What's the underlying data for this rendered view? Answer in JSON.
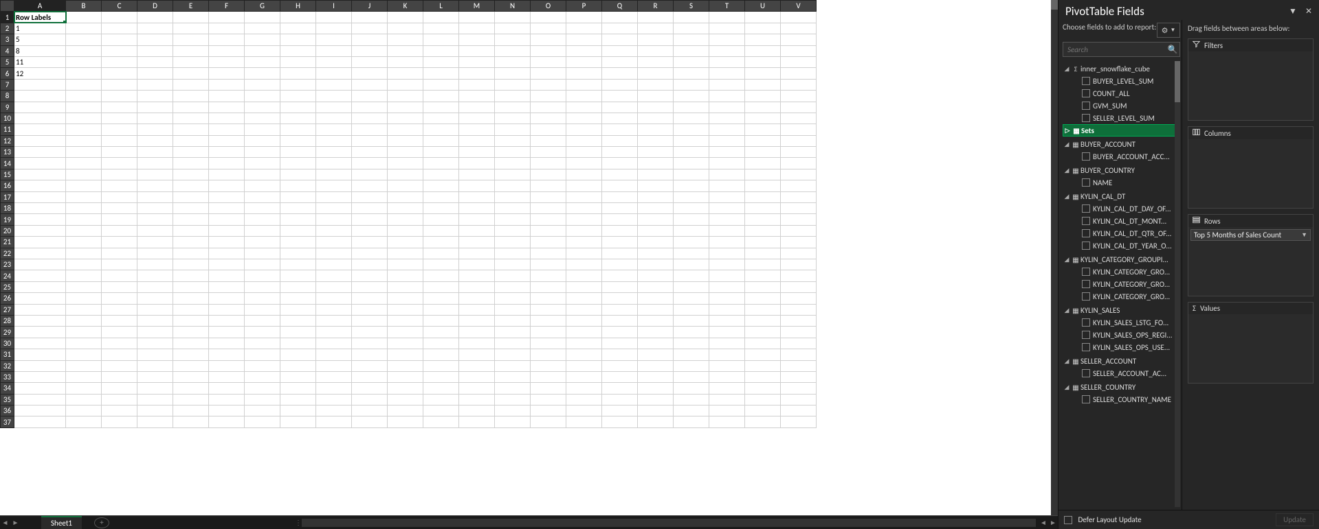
{
  "grid": {
    "columns": [
      "A",
      "B",
      "C",
      "D",
      "E",
      "F",
      "G",
      "H",
      "I",
      "J",
      "K",
      "L",
      "M",
      "N",
      "O",
      "P",
      "Q",
      "R",
      "S",
      "T",
      "U",
      "V"
    ],
    "row_count": 37,
    "cells": {
      "A1": "Row Labels",
      "A2": "1",
      "A3": "5",
      "A4": "8",
      "A5": "11",
      "A6": "12"
    },
    "active_cell": "A1"
  },
  "sheet_tabs": {
    "active": "Sheet1"
  },
  "pane": {
    "title": "PivotTable Fields",
    "choose_text": "Choose fields to add to report:",
    "search_placeholder": "Search",
    "drag_text": "Drag fields between areas below:",
    "areas": {
      "filters": "Filters",
      "columns": "Columns",
      "rows": "Rows",
      "values": "Values"
    },
    "rows_chip": "Top 5 Months of Sales Count",
    "defer_label": "Defer Layout Update",
    "update_label": "Update",
    "tree": [
      {
        "type": "cube",
        "label": "inner_snowflake_cube",
        "children": [
          {
            "type": "measure",
            "label": "BUYER_LEVEL_SUM"
          },
          {
            "type": "measure",
            "label": "COUNT_ALL"
          },
          {
            "type": "measure",
            "label": "GVM_SUM"
          },
          {
            "type": "measure",
            "label": "SELLER_LEVEL_SUM"
          }
        ]
      },
      {
        "type": "sets",
        "label": "Sets"
      },
      {
        "type": "dim",
        "label": "BUYER_ACCOUNT",
        "children": [
          {
            "type": "field",
            "label": "BUYER_ACCOUNT_ACC..."
          }
        ]
      },
      {
        "type": "dim",
        "label": "BUYER_COUNTRY",
        "children": [
          {
            "type": "field",
            "label": "NAME"
          }
        ]
      },
      {
        "type": "dim",
        "label": "KYLIN_CAL_DT",
        "children": [
          {
            "type": "field",
            "label": "KYLIN_CAL_DT_DAY_OF..."
          },
          {
            "type": "field",
            "label": "KYLIN_CAL_DT_MONT..."
          },
          {
            "type": "field",
            "label": "KYLIN_CAL_DT_QTR_OF..."
          },
          {
            "type": "field",
            "label": "KYLIN_CAL_DT_YEAR_O..."
          }
        ]
      },
      {
        "type": "dim",
        "label": "KYLIN_CATEGORY_GROUPI...",
        "children": [
          {
            "type": "field",
            "label": "KYLIN_CATEGORY_GRO..."
          },
          {
            "type": "field",
            "label": "KYLIN_CATEGORY_GRO..."
          },
          {
            "type": "field",
            "label": "KYLIN_CATEGORY_GRO..."
          }
        ]
      },
      {
        "type": "dim",
        "label": "KYLIN_SALES",
        "children": [
          {
            "type": "field",
            "label": "KYLIN_SALES_LSTG_FO..."
          },
          {
            "type": "field",
            "label": "KYLIN_SALES_OPS_REGI..."
          },
          {
            "type": "field",
            "label": "KYLIN_SALES_OPS_USE..."
          }
        ]
      },
      {
        "type": "dim",
        "label": "SELLER_ACCOUNT",
        "children": [
          {
            "type": "field",
            "label": "SELLER_ACCOUNT_AC..."
          }
        ]
      },
      {
        "type": "dim",
        "label": "SELLER_COUNTRY",
        "children": [
          {
            "type": "field",
            "label": "SELLER_COUNTRY_NAME"
          }
        ]
      }
    ]
  }
}
